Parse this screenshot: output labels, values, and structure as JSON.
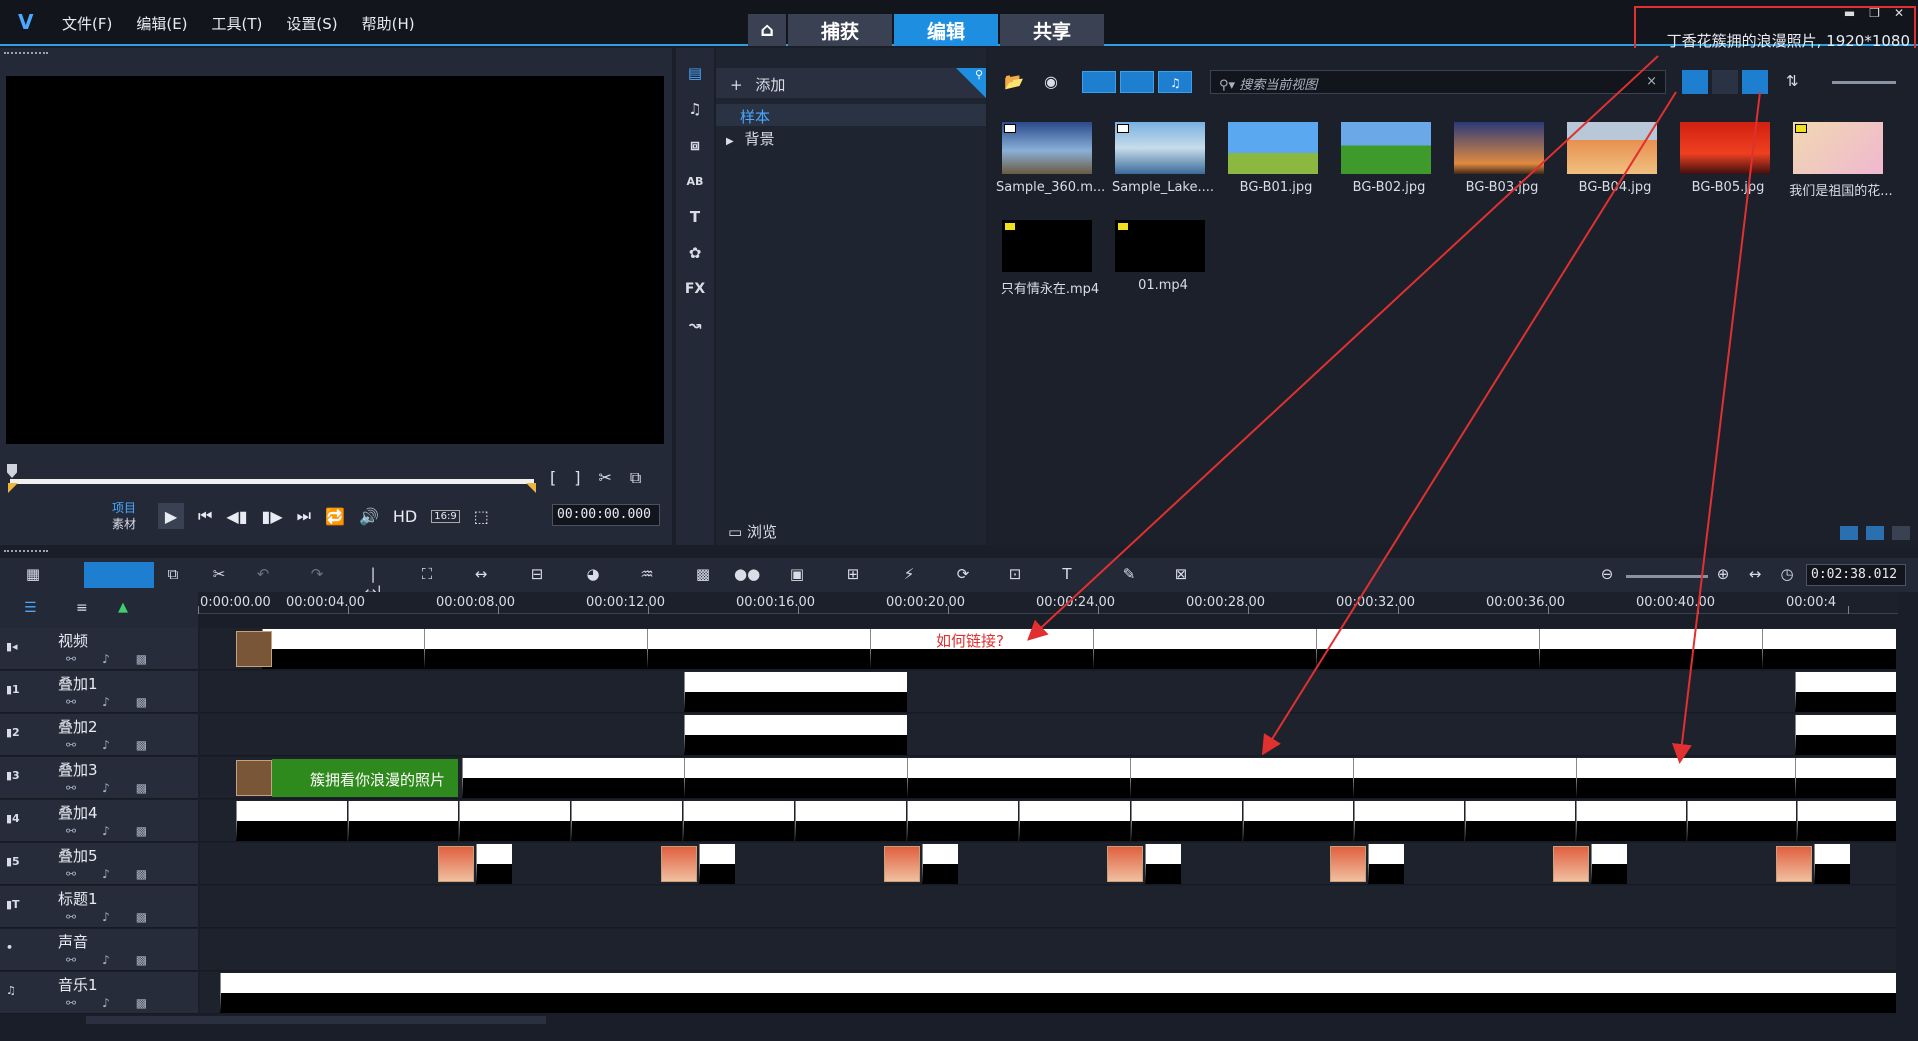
{
  "menu": [
    "文件(F)",
    "编辑(E)",
    "工具(T)",
    "设置(S)",
    "帮助(H)"
  ],
  "tabs": {
    "capture": "捕获",
    "edit": "编辑",
    "share": "共享"
  },
  "project_info": "丁香花簇拥的浪漫照片, 1920*1080",
  "preview": {
    "mode_project": "项目",
    "mode_clip": "素材",
    "hd": "HD",
    "aspect": "16:9",
    "timecode": "00:00:00.000"
  },
  "library": {
    "add": "添加",
    "tree": [
      "样本",
      "背景"
    ],
    "browse": "浏览",
    "search_placeholder": "搜索当前视图",
    "media": [
      {
        "name": "Sample_360.m...",
        "type": "video"
      },
      {
        "name": "Sample_Lake....",
        "type": "video"
      },
      {
        "name": "BG-B01.jpg",
        "type": "image"
      },
      {
        "name": "BG-B02.jpg",
        "type": "image"
      },
      {
        "name": "BG-B03.jpg",
        "type": "image"
      },
      {
        "name": "BG-B04.jpg",
        "type": "image"
      },
      {
        "name": "BG-B05.jpg",
        "type": "image"
      },
      {
        "name": "我们是祖国的花...",
        "type": "project"
      },
      {
        "name": "只有情永在.mp4",
        "type": "project"
      },
      {
        "name": "01.mp4",
        "type": "project"
      }
    ]
  },
  "timeline": {
    "timecode": "0:02:38.012",
    "ruler": [
      "0:00:00.00",
      "00:00:04.00",
      "00:00:08.00",
      "00:00:12.00",
      "00:00:16.00",
      "00:00:20.00",
      "00:00:24.00",
      "00:00:28.00",
      "00:00:32.00",
      "00:00:36.00",
      "00:00:40.00",
      "00:00:4"
    ],
    "tracks": [
      {
        "num": "",
        "name": "视频"
      },
      {
        "num": "1",
        "name": "叠加1"
      },
      {
        "num": "2",
        "name": "叠加2"
      },
      {
        "num": "3",
        "name": "叠加3"
      },
      {
        "num": "4",
        "name": "叠加4"
      },
      {
        "num": "5",
        "name": "叠加5"
      },
      {
        "num": "T",
        "name": "标题1"
      },
      {
        "num": "",
        "name": "声音"
      },
      {
        "num": "",
        "name": "音乐1"
      }
    ],
    "title_clip": "簇拥看你浪漫的照片",
    "annotation": "如何链接?"
  },
  "colors": {
    "accent": "#1e8fe0",
    "annotation": "#e03030"
  }
}
